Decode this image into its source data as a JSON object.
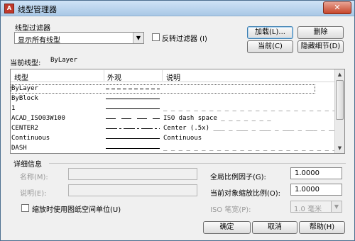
{
  "window": {
    "title": "线型管理器",
    "close_glyph": "✕"
  },
  "filter": {
    "label": "线型过滤器",
    "selected": "显示所有线型",
    "invert_label": "反转过滤器 (I)"
  },
  "buttons": {
    "load": "加载(L)...",
    "delete": "删除",
    "current": "当前(C)",
    "hide_details": "隐藏细节(D)",
    "ok": "确定",
    "cancel": "取消",
    "help": "帮助(H)"
  },
  "current_linetype": {
    "label": "当前线型:",
    "value": "ByLayer"
  },
  "table": {
    "headers": [
      "线型",
      "外观",
      "说明"
    ],
    "rows": [
      {
        "name": "ByLayer",
        "appearance": "dash",
        "description": ""
      },
      {
        "name": "ByBlock",
        "appearance": "solid",
        "description": ""
      },
      {
        "name": "1",
        "appearance": "solid",
        "description": "_ _ _ _ _ _ _ _ _ _ _ _ _ _ _ _ _ _ _ _ _ _ _ _ _"
      },
      {
        "name": "ACAD_ISO03W100",
        "appearance": "iso_dash_space",
        "description": "ISO dash space _   _   _   _   _   _   _"
      },
      {
        "name": "CENTER2",
        "appearance": "center",
        "description": "Center (.5x) ___ _ ___ _ ___ _ ___ _ ___ _ ___"
      },
      {
        "name": "Continuous",
        "appearance": "solid",
        "description": "Continuous"
      },
      {
        "name": "DASH",
        "appearance": "solid",
        "description": "_ _ _ _ _ _ _ _ _ _ _ _ _ _ _ _ _ _ _ _ _ _ _ _ _"
      }
    ]
  },
  "details": {
    "label": "详细信息",
    "name_label": "名称(M):",
    "desc_label": "说明(E):",
    "paper_space_label": "缩放时使用图纸空间单位(U)",
    "global_scale_label": "全局比例因子(G):",
    "global_scale_value": "1.0000",
    "object_scale_label": "当前对象缩放比例(O):",
    "object_scale_value": "1.0000",
    "iso_pen_label": "ISO 笔宽(P):",
    "iso_pen_value": "1.0 毫米"
  },
  "icons": {
    "dropdown": "chevron-down-icon",
    "scroll_up": "arrow-up-icon",
    "scroll_down": "arrow-down-icon"
  }
}
